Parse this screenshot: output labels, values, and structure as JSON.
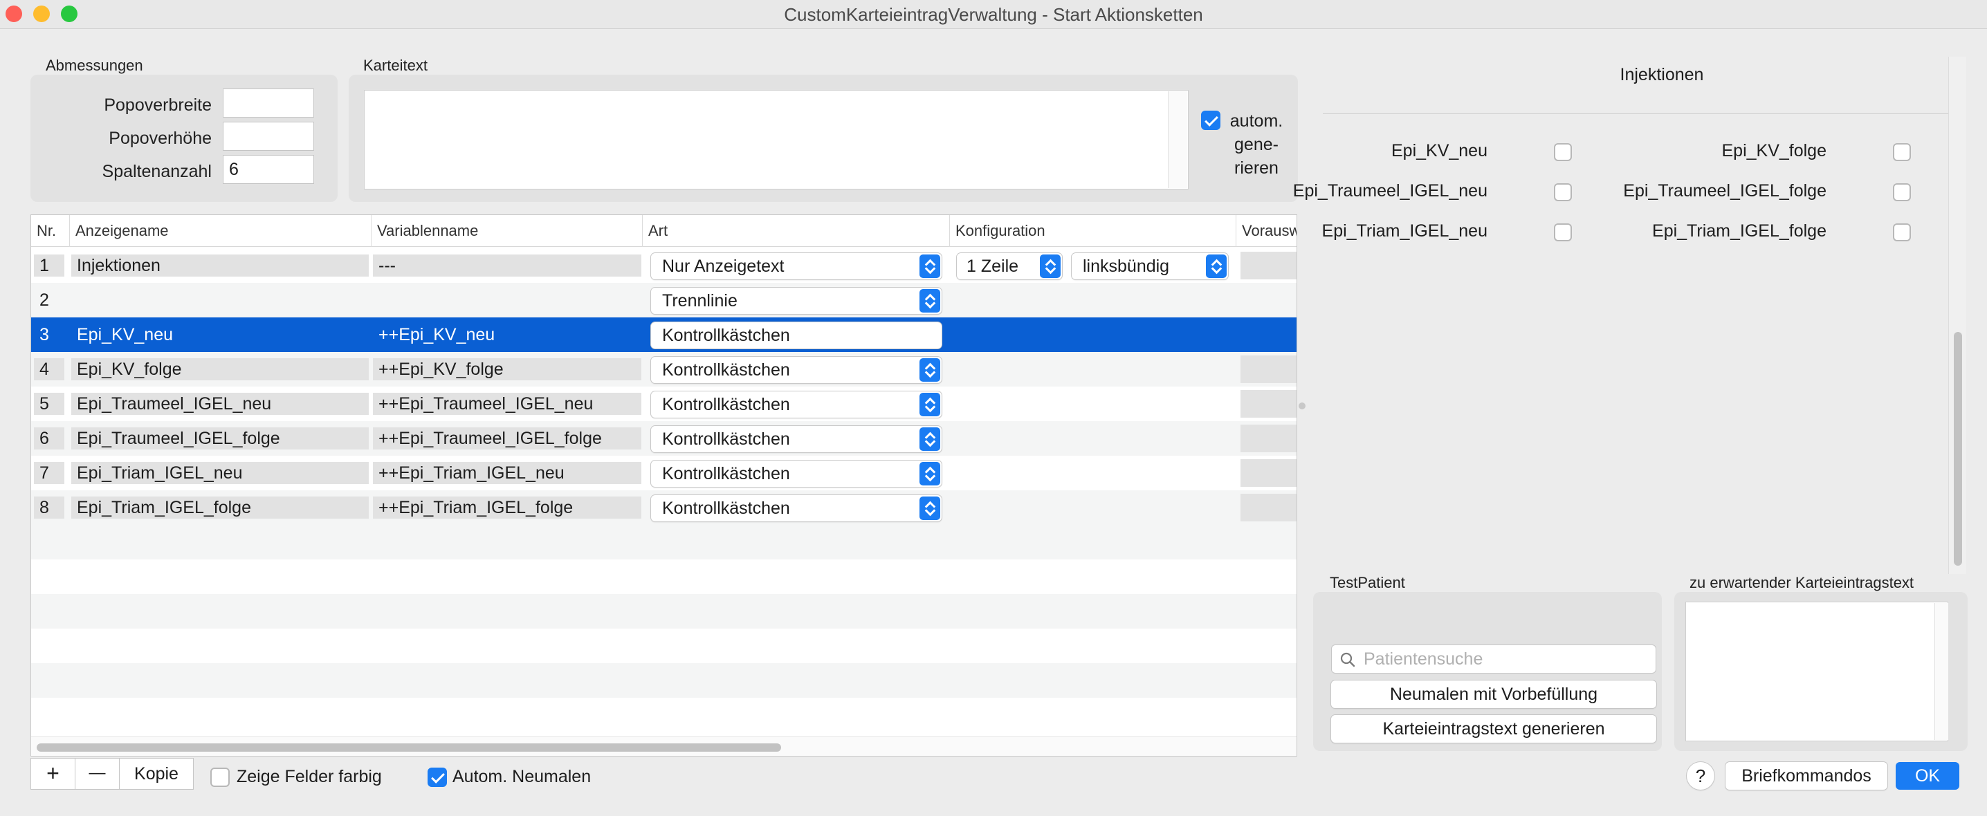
{
  "window": {
    "title": "CustomKarteieintragVerwaltung - Start Aktionsketten"
  },
  "abmessungen": {
    "title": "Abmessungen",
    "fields": [
      {
        "label": "Popoverbreite",
        "value": ""
      },
      {
        "label": "Popoverhöhe",
        "value": ""
      },
      {
        "label": "Spaltenanzahl",
        "value": "6"
      }
    ]
  },
  "karteitext": {
    "title": "Karteitext",
    "value": "",
    "auto_label_1": "autom.",
    "auto_label_2": "gene-",
    "auto_label_3": "rieren",
    "auto_checked": true
  },
  "table": {
    "columns": [
      "Nr.",
      "Anzeigename",
      "Variablenname",
      "Art",
      "Konfiguration",
      "Vorausw"
    ],
    "rows": [
      {
        "nr": "1",
        "name": "Injektionen",
        "var": "---",
        "art": "Nur Anzeigetext",
        "conf1": "1 Zeile",
        "conf2": "linksbündig"
      },
      {
        "nr": "2",
        "name": "",
        "var": "",
        "art": "Trennlinie"
      },
      {
        "nr": "3",
        "name": "Epi_KV_neu",
        "var": "++Epi_KV_neu",
        "art": "Kontrollkästchen"
      },
      {
        "nr": "4",
        "name": "Epi_KV_folge",
        "var": "++Epi_KV_folge",
        "art": "Kontrollkästchen"
      },
      {
        "nr": "5",
        "name": "Epi_Traumeel_IGEL_neu",
        "var": "++Epi_Traumeel_IGEL_neu",
        "art": "Kontrollkästchen"
      },
      {
        "nr": "6",
        "name": "Epi_Traumeel_IGEL_folge",
        "var": "++Epi_Traumeel_IGEL_folge",
        "art": "Kontrollkästchen"
      },
      {
        "nr": "7",
        "name": "Epi_Triam_IGEL_neu",
        "var": "++Epi_Triam_IGEL_neu",
        "art": "Kontrollkästchen"
      },
      {
        "nr": "8",
        "name": "Epi_Triam_IGEL_folge",
        "var": "++Epi_Triam_IGEL_folge",
        "art": "Kontrollkästchen"
      }
    ],
    "selected_row": "3"
  },
  "bottom_bar": {
    "add_label": "+",
    "remove_label": "—",
    "copy_label": "Kopie",
    "zeige_felder_label": "Zeige Felder farbig",
    "zeige_felder_checked": false,
    "autom_neumalen_label": "Autom. Neumalen",
    "autom_neumalen_checked": true
  },
  "preview": {
    "title": "Injektionen",
    "items": [
      {
        "label": "Epi_KV_neu",
        "checked": false
      },
      {
        "label": "Epi_KV_folge",
        "checked": false
      },
      {
        "label": "Epi_Traumeel_IGEL_neu",
        "checked": false
      },
      {
        "label": "Epi_Traumeel_IGEL_folge",
        "checked": false
      },
      {
        "label": "Epi_Triam_IGEL_neu",
        "checked": false
      },
      {
        "label": "Epi_Triam_IGEL_folge",
        "checked": false
      }
    ]
  },
  "testpatient": {
    "title": "TestPatient",
    "search_placeholder": "Patientensuche",
    "neumalen_button": "Neumalen mit Vorbefüllung",
    "generieren_button": "Karteieintragstext generieren"
  },
  "expected": {
    "title": "zu erwartender Karteieintragstext",
    "value": ""
  },
  "footer": {
    "help_label": "?",
    "briefkommandos_label": "Briefkommandos",
    "ok_label": "OK"
  },
  "colors": {
    "accent": "#1a7cf3",
    "selection": "#0a5fd3",
    "window_bg": "#ececec"
  }
}
